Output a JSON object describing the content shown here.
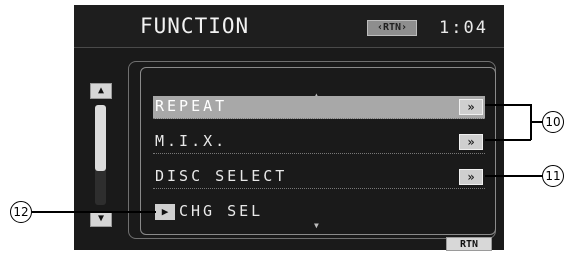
{
  "header": {
    "title": "FUNCTION",
    "rtn_badge": "RTN",
    "clock": "1:04"
  },
  "menu": {
    "items": [
      {
        "label": "REPEAT",
        "button": "»",
        "selected": true
      },
      {
        "label": "M.I.X.",
        "button": "»",
        "selected": false
      },
      {
        "label": "DISC SELECT",
        "button": "»",
        "selected": false
      },
      {
        "label": "CHG SEL",
        "icon": "play-icon",
        "selected": false
      }
    ]
  },
  "scrollbar": {
    "up_icon": "up-arrow-icon",
    "down_icon": "down-arrow-icon"
  },
  "footer": {
    "rtn_label": "RTN"
  },
  "callouts": {
    "c10": "10",
    "c11": "11",
    "c12": "12"
  }
}
